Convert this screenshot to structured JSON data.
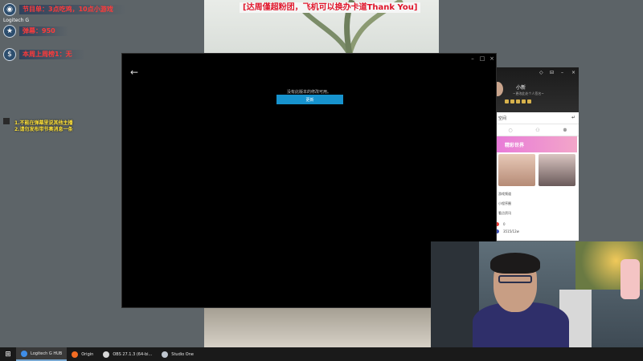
{
  "stream_overlay": {
    "marquee": "[达周僅超粉团，飞机可以换办卡道Thank You]",
    "rows": [
      {
        "label": "节目单：3点吃鸡，10点小游戏",
        "icon": "camera-icon"
      },
      {
        "label": "弹幕：950",
        "icon": "star-icon"
      },
      {
        "label": "本周上周榜1：无",
        "icon": "dollar-icon"
      }
    ],
    "logitech_caption": "Logitech G",
    "notes": [
      "1.不能在弹幕里说其他主播",
      "2.请勿发布带节奏消息一条"
    ]
  },
  "main_window": {
    "message": "没有此版本的修改可用。",
    "button_label": "更新",
    "controls": {
      "minimize": "–",
      "maximize": "□",
      "close": "×"
    },
    "back_glyph": "←"
  },
  "qq_panel": {
    "name": "小新",
    "signature": "~更改此处个人签名~",
    "controls": {
      "skin": "◇",
      "tile": "⊟",
      "minimize": "–",
      "close": "×"
    },
    "menu_label": "空间",
    "arrow": "↵",
    "banner": "精彩世界",
    "list_items": [
      "游戏频道",
      "小程序圈",
      "看点资讯"
    ],
    "count_a": "0",
    "count_b": "3515/12w",
    "tab_icons": [
      "chat-icon",
      "contact-icon",
      "group-icon"
    ]
  },
  "taskbar": {
    "start_glyph": "⊞",
    "items": [
      {
        "label": "Logitech G HUB",
        "active": true,
        "color": "#3f8ee8"
      },
      {
        "label": "Origin",
        "active": false,
        "color": "#f26c23"
      },
      {
        "label": "OBS 27.1.3 (64-bi...",
        "active": false,
        "color": "#d8d8d8"
      },
      {
        "label": "Studio One",
        "active": false,
        "color": "#bfc6cf"
      }
    ]
  }
}
